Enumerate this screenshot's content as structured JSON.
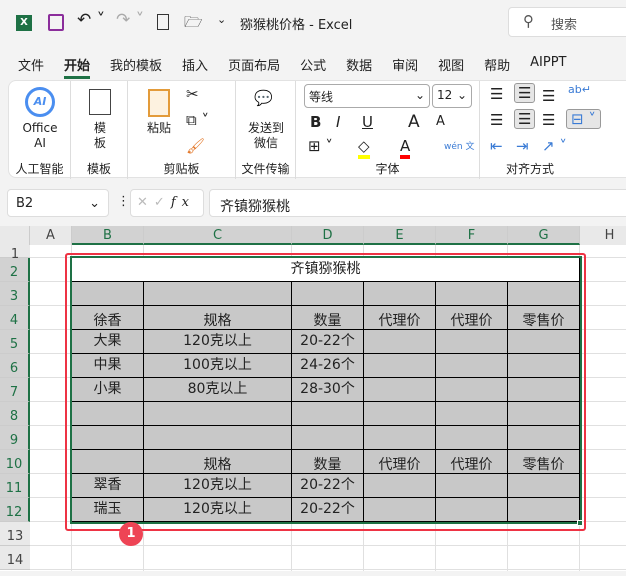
{
  "titlebar": {
    "title": "猕猴桃价格  -  Excel",
    "search_placeholder": "搜索",
    "excel_icon": "X"
  },
  "menu": [
    "文件",
    "开始",
    "我的模板",
    "插入",
    "页面布局",
    "公式",
    "数据",
    "审阅",
    "视图",
    "帮助",
    "AIPPT"
  ],
  "ribbon": {
    "office_ai": "Office AI",
    "ai_logo": "AI",
    "template": "模板",
    "paste": "粘贴",
    "send": "发送到微信",
    "font_name": "等线",
    "font_size": "12",
    "bold": "B",
    "italic": "I",
    "underline": "U",
    "grow": "A",
    "shrink": "A",
    "font_color": "A",
    "wen": "wén 文",
    "groups": [
      "人工智能",
      "模板",
      "剪贴板",
      "文件传输",
      "字体",
      "对齐方式"
    ],
    "colors": {
      "highlight": "#ffff00",
      "font_color": "#ff0000"
    }
  },
  "formula_bar": {
    "name_box": "B2",
    "fx": "fx",
    "value": "齐镇猕猴桃"
  },
  "columns": [
    "A",
    "B",
    "C",
    "D",
    "E",
    "F",
    "G",
    "H"
  ],
  "rows": [
    "1",
    "2",
    "3",
    "4",
    "5",
    "6",
    "7",
    "8",
    "9",
    "10",
    "11",
    "12",
    "13",
    "14"
  ],
  "table": {
    "title": "齐镇猕猴桃",
    "rows": [
      [
        "",
        "",
        "",
        "",
        "",
        ""
      ],
      [
        "徐香",
        "规格",
        "数量",
        "代理价",
        "代理价",
        "零售价"
      ],
      [
        "大果",
        "120克以上",
        "20-22个",
        "",
        "",
        ""
      ],
      [
        "中果",
        "100克以上",
        "24-26个",
        "",
        "",
        ""
      ],
      [
        "小果",
        "80克以上",
        "28-30个",
        "",
        "",
        ""
      ],
      [
        "",
        "",
        "",
        "",
        "",
        ""
      ],
      [
        "",
        "",
        "",
        "",
        "",
        ""
      ],
      [
        "",
        "规格",
        "数量",
        "代理价",
        "代理价",
        "零售价"
      ],
      [
        "翠香",
        "120克以上",
        "20-22个",
        "",
        "",
        ""
      ],
      [
        "瑞玉",
        "120克以上",
        "20-22个",
        "",
        "",
        ""
      ]
    ]
  },
  "annotation": {
    "badge": "1",
    "color": "#ee3344"
  },
  "accent": "#1e7145"
}
